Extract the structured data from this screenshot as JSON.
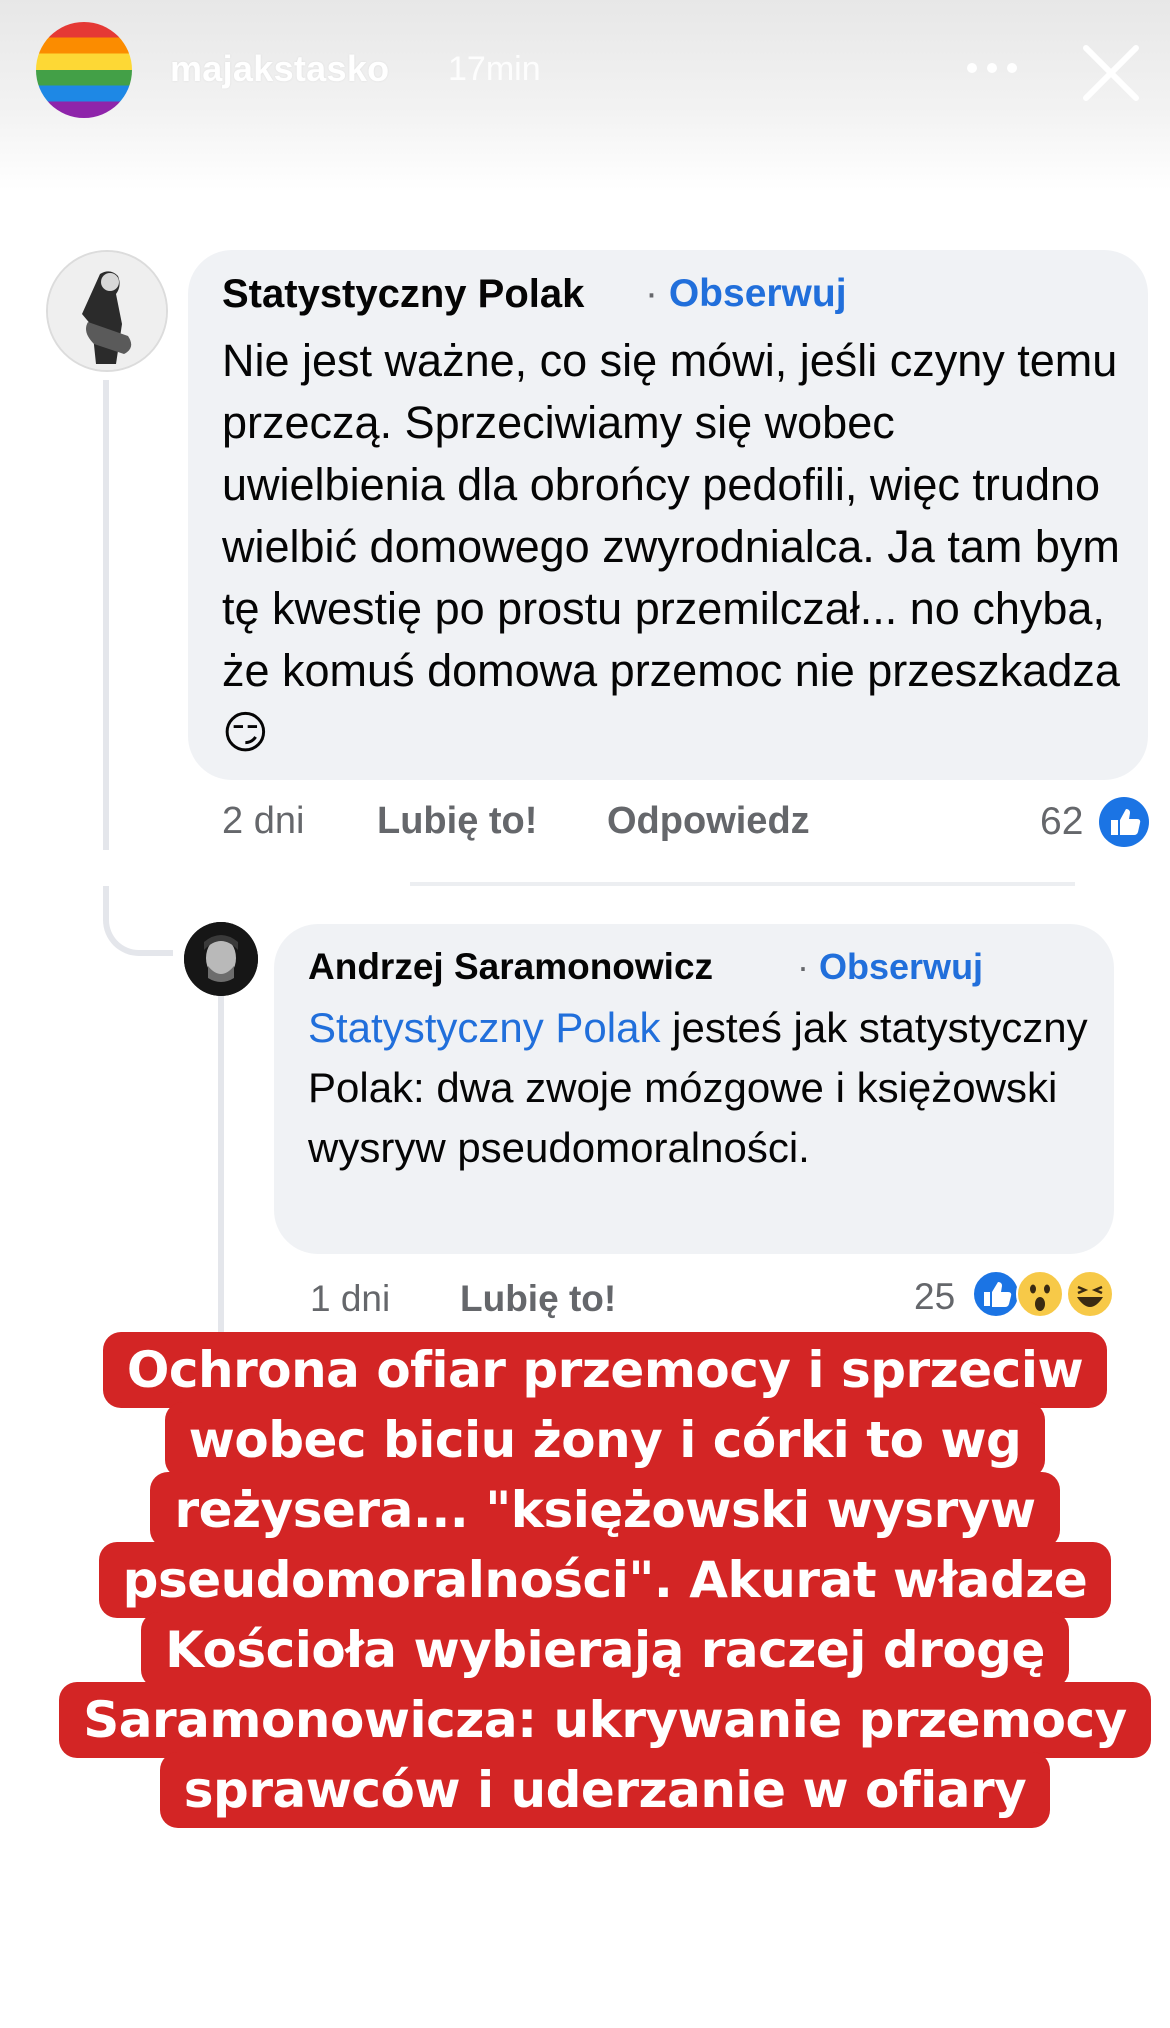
{
  "story": {
    "username": "majakstasko",
    "time": "17min"
  },
  "comment": {
    "author": "Statystyczny Polak",
    "separator": "·",
    "follow_label": "Obserwuj",
    "text": "Nie jest ważne, co się mówi, jeśli czyny temu przeczą. Sprzeciwiamy się wobec uwielbienia dla obrońcy pedofili, więc trudno wielbić domowego zwyrodnialca. Ja tam bym tę kwestię po prostu przemilczał... no chyba, że komuś domowa przemoc nie przeszkadza",
    "emoji": "😏",
    "age": "2 dni",
    "like_label": "Lubię to!",
    "reply_label": "Odpowiedz",
    "reaction_count": "62"
  },
  "reply": {
    "author": "Andrzej Saramonowicz",
    "separator": "·",
    "follow_label": "Obserwuj",
    "mention": "Statystyczny Polak",
    "text": " jesteś jak statystyczny Polak: dwa zwoje mózgowe i księżowski wysryw pseudomoralności.",
    "age": "1 dni",
    "like_label": "Lubię to!",
    "reaction_count": "25"
  },
  "caption": {
    "lines": [
      "Ochrona ofiar przemocy i sprzeciw",
      "wobec biciu żony i córki to wg",
      "reżysera... \"księżowski wysryw",
      "pseudomoralności\". Akurat władze",
      "Kościoła wybierają raczej drogę",
      "Saramonowicza: ukrywanie przemocy",
      "sprawców i uderzanie w ofiary"
    ]
  },
  "colors": {
    "link_blue": "#216fdb",
    "bubble_gray": "#f0f2f5",
    "caption_red": "#d32525"
  },
  "icons": [
    "more-icon",
    "close-icon",
    "like-reaction-icon",
    "wow-reaction-icon",
    "haha-reaction-icon"
  ]
}
